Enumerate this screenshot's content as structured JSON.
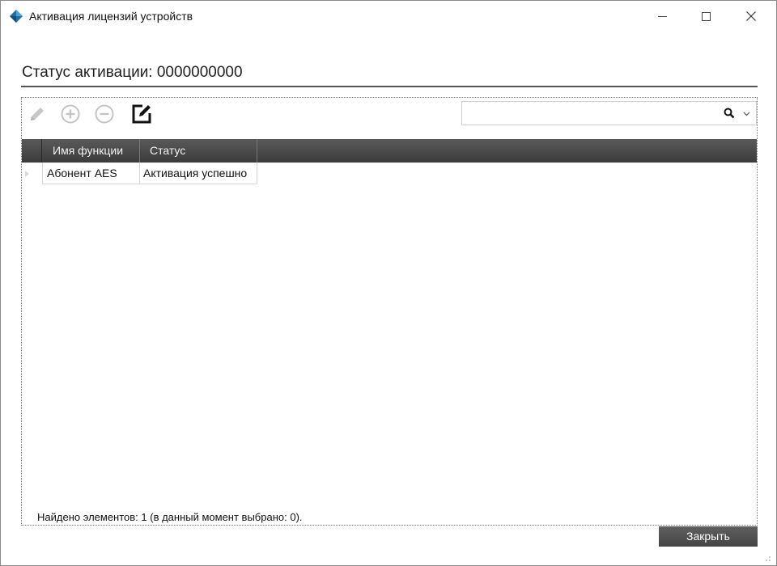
{
  "window": {
    "title": "Активация лицензий устройств",
    "icon": "app-diamond-icon"
  },
  "heading": {
    "label": "Статус активации: 0000000000"
  },
  "toolbar": {
    "icons": [
      "pencil-icon",
      "plus-circle-icon",
      "minus-circle-icon",
      "external-edit-icon"
    ]
  },
  "search": {
    "value": "",
    "placeholder": ""
  },
  "grid": {
    "columns": [
      "Имя функции",
      "Статус"
    ],
    "rows": [
      [
        "Абонент AES",
        "Активация успешно"
      ]
    ]
  },
  "status": {
    "found": "Найдено элементов: 1 (в данный момент выбрано: 0)."
  },
  "buttons": {
    "close": "Закрыть"
  },
  "colors": {
    "header_dark": "#3b3b3b",
    "accent_blue": "#1f6fa8"
  }
}
